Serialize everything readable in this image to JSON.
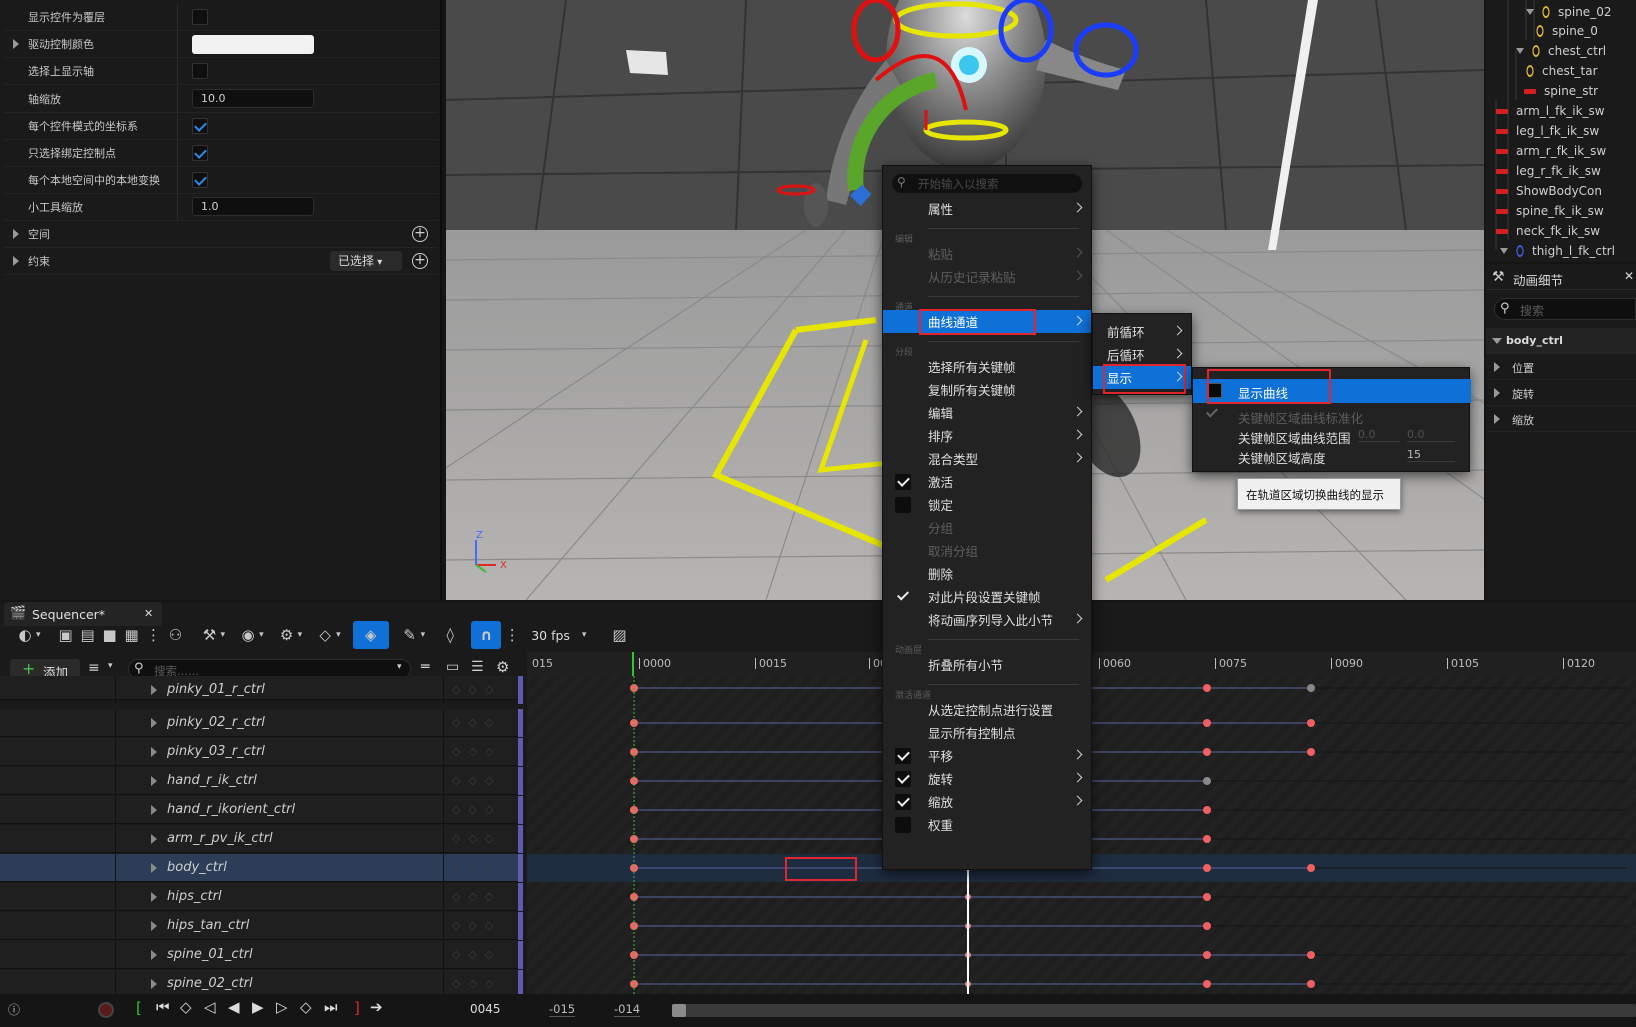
{
  "details": {
    "rows": [
      {
        "label": "显示控件为覆层",
        "type": "checkbox",
        "checked": false
      },
      {
        "label": "驱动控制颜色",
        "type": "color",
        "expandable": true
      },
      {
        "label": "选择上显示轴",
        "type": "checkbox",
        "checked": false
      },
      {
        "label": "轴缩放",
        "type": "number",
        "value": "10.0"
      },
      {
        "label": "每个控件模式的坐标系",
        "type": "checkbox",
        "checked": true
      },
      {
        "label": "只选择绑定控制点",
        "type": "checkbox",
        "checked": true
      },
      {
        "label": "每个本地空间中的本地变换",
        "type": "checkbox",
        "checked": true
      },
      {
        "label": "小工具缩放",
        "type": "number",
        "value": "1.0"
      },
      {
        "label": "空间",
        "type": "group",
        "expandable": true
      },
      {
        "label": "约束",
        "type": "group",
        "expandable": true,
        "dropdown": "已选择"
      }
    ]
  },
  "viewport": {
    "axis_z": "Z",
    "axis_x": "X"
  },
  "outliner": {
    "items": [
      {
        "label": "spine_02",
        "icon": "bone-icon"
      },
      {
        "label": "spine_0",
        "icon": "bone-icon"
      },
      {
        "label": "chest_ctrl",
        "icon": "bone-icon"
      },
      {
        "label": "chest_tar",
        "icon": "bone-icon"
      },
      {
        "label": "spine_str",
        "icon": "control-icon"
      },
      {
        "label": "arm_l_fk_ik_sw",
        "icon": "control-icon"
      },
      {
        "label": "leg_l_fk_ik_sw",
        "icon": "control-icon"
      },
      {
        "label": "arm_r_fk_ik_sw",
        "icon": "control-icon"
      },
      {
        "label": "leg_r_fk_ik_sw",
        "icon": "control-icon"
      },
      {
        "label": "ShowBodyCon",
        "icon": "control-icon"
      },
      {
        "label": "spine_fk_ik_sw",
        "icon": "control-icon"
      },
      {
        "label": "neck_fk_ik_sw",
        "icon": "control-icon"
      },
      {
        "label": "thigh_l_fk_ctrl",
        "icon": "bone-icon"
      }
    ]
  },
  "anim_details": {
    "title": "动画细节",
    "search_placeholder": "搜索",
    "object": "body_ctrl",
    "props": [
      "位置",
      "旋转",
      "缩放"
    ]
  },
  "sequencer": {
    "tab_label": "Sequencer*",
    "add_label": "添加",
    "search_placeholder": "搜索......",
    "fps": "30 fps",
    "current_frame": "0045",
    "range_start": "-015",
    "range_end": "-014",
    "ruler": [
      "015",
      "0000",
      "0015",
      "00",
      "0060",
      "0075",
      "0090",
      "0105",
      "0120"
    ],
    "tracks": [
      "pinky_01_r_ctrl",
      "pinky_02_r_ctrl",
      "pinky_03_r_ctrl",
      "hand_r_ik_ctrl",
      "hand_r_ikorient_ctrl",
      "arm_r_pv_ik_ctrl",
      "body_ctrl",
      "hips_ctrl",
      "hips_tan_ctrl",
      "spine_01_ctrl",
      "spine_02_ctrl"
    ],
    "selected_track": "body_ctrl"
  },
  "context_menu": {
    "search_placeholder": "开始输入以搜索",
    "items": [
      {
        "label": "属性",
        "sub": true
      },
      {
        "section": "编辑"
      },
      {
        "label": "粘贴",
        "sub": true,
        "disabled": true
      },
      {
        "label": "从历史记录粘贴",
        "sub": true,
        "disabled": true
      },
      {
        "section": "通道"
      },
      {
        "label": "曲线通道",
        "sub": true,
        "selected": true
      },
      {
        "section": "分段"
      },
      {
        "label": "选择所有关键帧"
      },
      {
        "label": "复制所有关键帧"
      },
      {
        "label": "编辑",
        "sub": true
      },
      {
        "label": "排序",
        "sub": true
      },
      {
        "label": "混合类型",
        "sub": true
      },
      {
        "label": "激活",
        "checkbox": true,
        "checked": true
      },
      {
        "label": "锁定",
        "checkbox": true,
        "checked": false
      },
      {
        "label": "分组",
        "disabled": true
      },
      {
        "label": "取消分组",
        "disabled": true
      },
      {
        "label": "删除"
      },
      {
        "label": "对此片段设置关键帧",
        "tick": true
      },
      {
        "label": "将动画序列导入此小节",
        "sub": true
      },
      {
        "section": "动画层"
      },
      {
        "label": "折叠所有小节"
      },
      {
        "section": "激活通道"
      },
      {
        "label": "从选定控制点进行设置"
      },
      {
        "label": "显示所有控制点"
      },
      {
        "label": "平移",
        "checkbox": true,
        "checked": true,
        "sub": true
      },
      {
        "label": "旋转",
        "checkbox": true,
        "checked": true,
        "sub": true
      },
      {
        "label": "缩放",
        "checkbox": true,
        "checked": true,
        "sub": true
      },
      {
        "label": "权重",
        "checkbox": true,
        "checked": false
      }
    ]
  },
  "submenu1": {
    "items": [
      "前循环",
      "后循环",
      "显示"
    ],
    "selected": "显示"
  },
  "submenu2": {
    "show_curve": "显示曲线",
    "normalize": "关键帧区域曲线标准化",
    "range_label": "关键帧区域曲线范围",
    "range_min": "0.0",
    "range_max": "0.0",
    "height_label": "关键帧区域高度",
    "height_value": "15"
  },
  "tooltip": "在轨道区域切换曲线的显示"
}
